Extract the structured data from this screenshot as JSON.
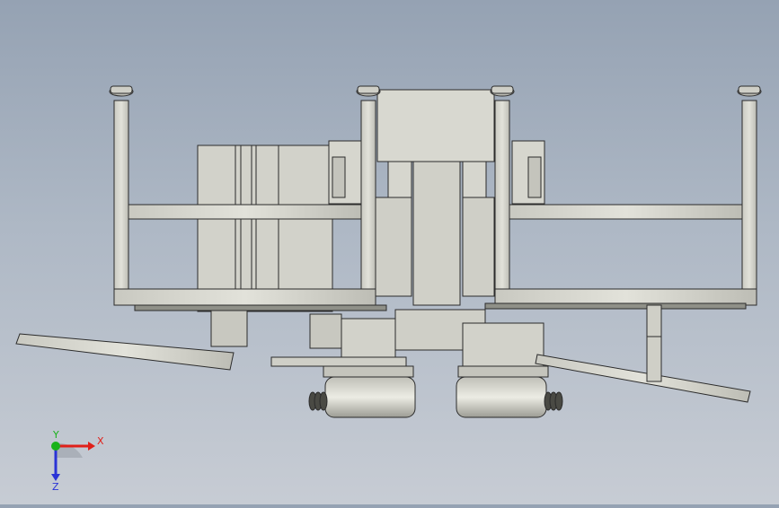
{
  "viewport": {
    "background_top": "#95a2b3",
    "background_bottom": "#c7ccd4",
    "model_fill": "#d6d6ce",
    "model_edge": "#2b2b2b",
    "model_dark": "#8f9088"
  },
  "triad": {
    "x_label": "X",
    "y_label": "Y",
    "z_label": "Z",
    "x_color": "#e0201a",
    "y_color": "#19b219",
    "z_color": "#2a33d6"
  }
}
